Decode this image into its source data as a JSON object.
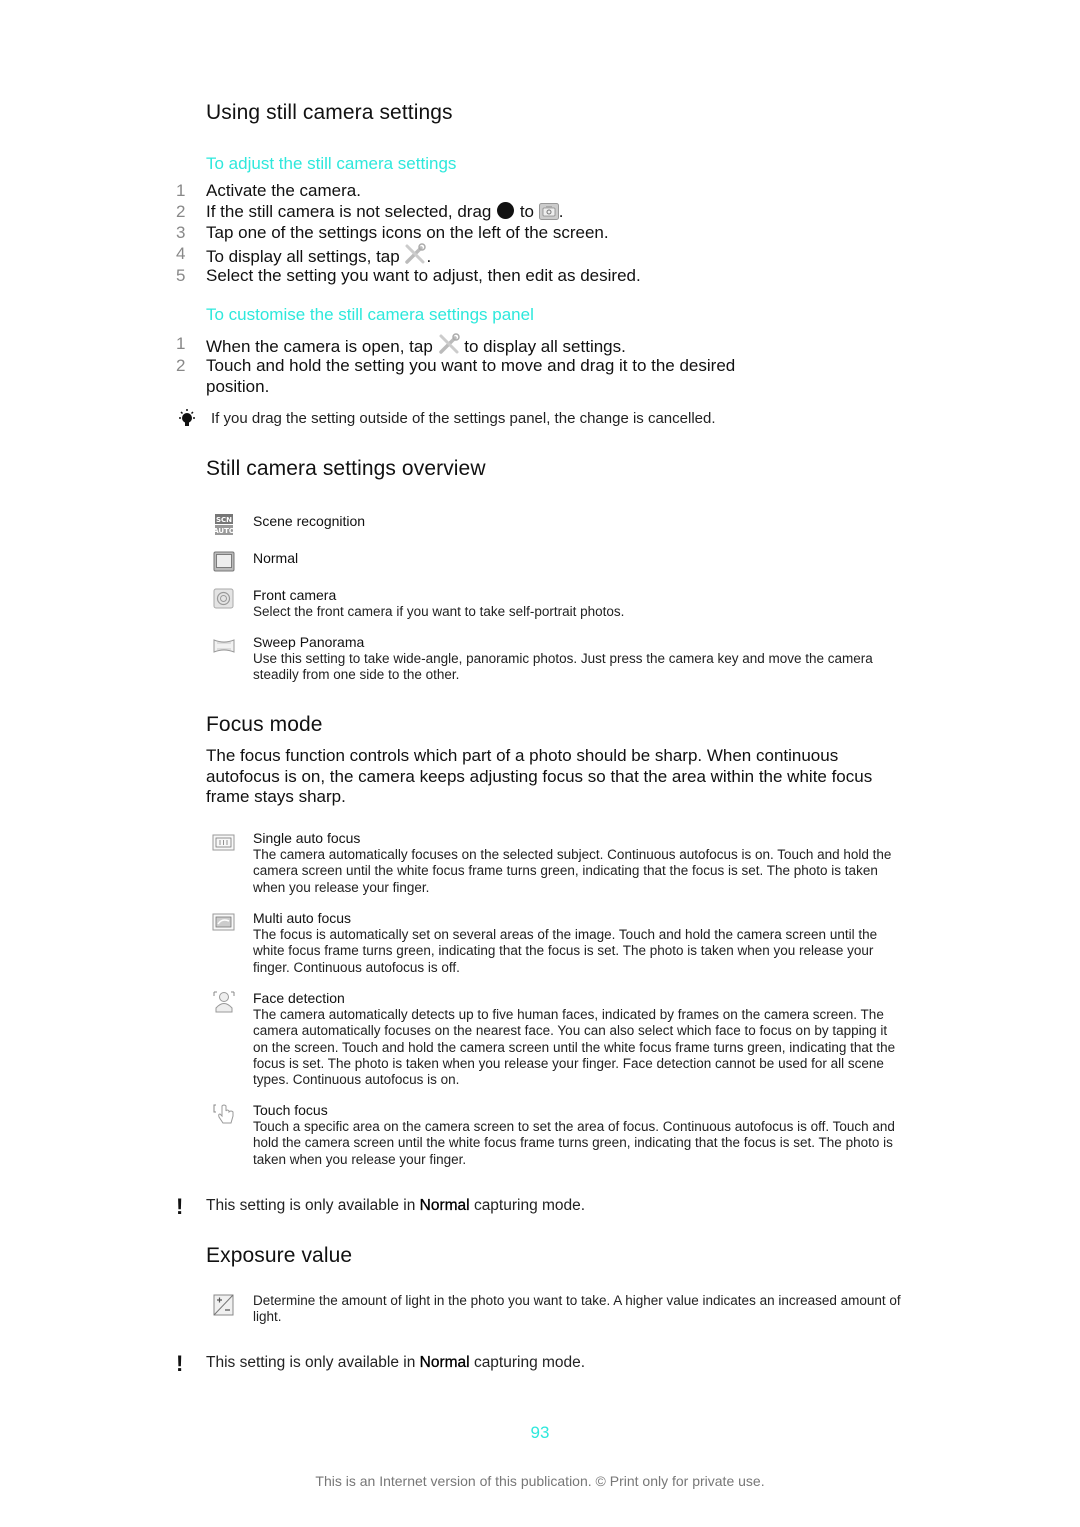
{
  "sections": {
    "using": {
      "title": "Using still camera settings",
      "adjust": {
        "heading": "To adjust the still camera settings",
        "steps": [
          {
            "num": "1",
            "text": "Activate the camera."
          },
          {
            "num": "2",
            "text_before": "If the still camera is not selected, drag",
            "text_mid": "to",
            "text_after": ".",
            "icons": [
              "black-dot-slider-icon",
              "camera-icon"
            ]
          },
          {
            "num": "3",
            "text": "Tap one of the settings icons on the left of the screen."
          },
          {
            "num": "4",
            "text_before": "To display all settings, tap",
            "text_after": ".",
            "icons": [
              "settings-tools-icon"
            ]
          },
          {
            "num": "5",
            "text": "Select the setting you want to adjust, then edit as desired."
          }
        ]
      },
      "customise": {
        "heading": "To customise the still camera settings panel",
        "steps": [
          {
            "num": "1",
            "text_before": "When the camera is open, tap",
            "text_after": "to display all settings.",
            "icons": [
              "settings-tools-icon"
            ]
          },
          {
            "num": "2",
            "text": "Touch and hold the setting you want to move and drag it to the desired position."
          }
        ]
      },
      "tip": {
        "icon": "lightbulb-tip-icon",
        "text": "If you drag the setting outside of the settings panel, the change is cancelled."
      }
    },
    "overview": {
      "title": "Still camera settings overview",
      "items": [
        {
          "icon": "scene-recognition-icon",
          "title": "Scene recognition",
          "desc": ""
        },
        {
          "icon": "normal-mode-icon",
          "title": "Normal",
          "desc": ""
        },
        {
          "icon": "front-camera-icon",
          "title": "Front camera",
          "desc": "Select the front camera if you want to take self-portrait photos."
        },
        {
          "icon": "sweep-panorama-icon",
          "title": "Sweep Panorama",
          "desc": "Use this setting to take wide-angle, panoramic photos. Just press the camera key and move the camera steadily from one side to the other."
        }
      ]
    },
    "focus": {
      "title": "Focus mode",
      "intro": "The focus function controls which part of a photo should be sharp. When continuous autofocus is on, the camera keeps adjusting focus so that the area within the white focus frame stays sharp.",
      "items": [
        {
          "icon": "single-auto-focus-icon",
          "title": "Single auto focus",
          "desc": "The camera automatically focuses on the selected subject. Continuous autofocus is on. Touch and hold the camera screen until the white focus frame turns green, indicating that the focus is set. The photo is taken when you release your finger."
        },
        {
          "icon": "multi-auto-focus-icon",
          "title": "Multi auto focus",
          "desc": "The focus is automatically set on several areas of the image. Touch and hold the camera screen until the white focus frame turns green, indicating that the focus is set. The photo is taken when you release your finger. Continuous autofocus is off."
        },
        {
          "icon": "face-detection-icon",
          "title": "Face detection",
          "desc": "The camera automatically detects up to five human faces, indicated by frames on the camera screen. The camera automatically focuses on the nearest face. You can also select which face to focus on by tapping it on the screen. Touch and hold the camera screen until the white focus frame turns green, indicating that the focus is set. The photo is taken when you release your finger. Face detection cannot be used for all scene types. Continuous autofocus is on."
        },
        {
          "icon": "touch-focus-icon",
          "title": "Touch focus",
          "desc": "Touch a specific area on the camera screen to set the area of focus. Continuous autofocus is off. Touch and hold the camera screen until the white focus frame turns green, indicating that the focus is set. The photo is taken when you release your finger."
        }
      ],
      "warning": {
        "before": "This setting is only available in",
        "bold": "Normal",
        "after": "capturing mode."
      }
    },
    "exposure": {
      "title": "Exposure value",
      "item": {
        "icon": "exposure-value-icon",
        "desc": "Determine the amount of light in the photo you want to take. A higher value indicates an increased amount of light."
      },
      "warning": {
        "before": "This setting is only available in",
        "bold": "Normal",
        "after": "capturing mode."
      }
    }
  },
  "page_number": "93",
  "footer": "This is an Internet version of this publication. © Print only for private use.",
  "colors": {
    "accent": "#2ee8dc",
    "text": "#111111",
    "step_number": "#888888",
    "footer": "#777777"
  }
}
